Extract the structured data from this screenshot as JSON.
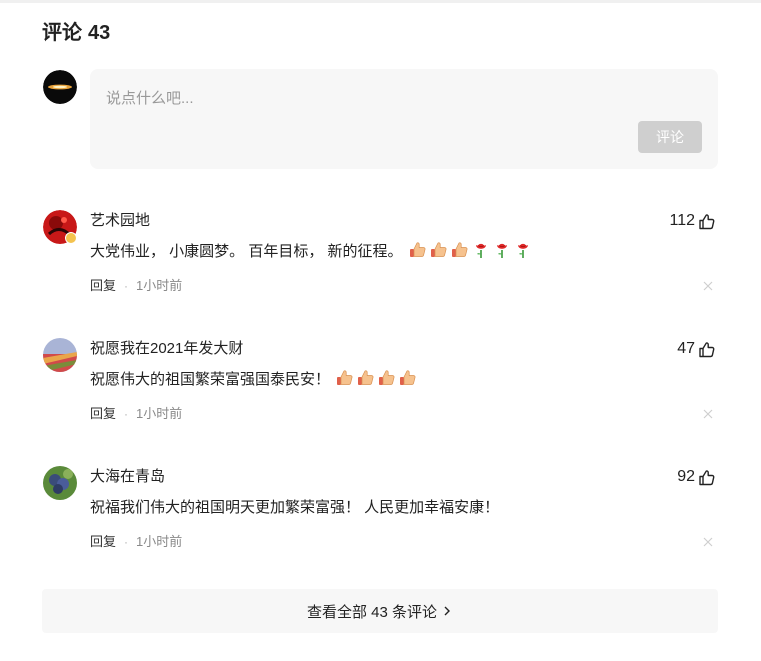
{
  "header": {
    "title": "评论",
    "count": "43"
  },
  "composer": {
    "placeholder": "说点什么吧...",
    "submit_label": "评论"
  },
  "comments": [
    {
      "name": "艺术园地",
      "likes": "112",
      "text": "大党伟业， 小康圆梦。 百年目标， 新的征程。",
      "emojis": [
        "thumbs-up",
        "thumbs-up",
        "thumbs-up",
        "rose",
        "rose",
        "rose"
      ],
      "reply_label": "回复",
      "separator": "·",
      "time": "1小时前",
      "verified": true
    },
    {
      "name": "祝愿我在2021年发大财",
      "likes": "47",
      "text": "祝愿伟大的祖国繁荣富强国泰民安！",
      "emojis": [
        "thumbs-up",
        "thumbs-up",
        "thumbs-up",
        "thumbs-up"
      ],
      "reply_label": "回复",
      "separator": "·",
      "time": "1小时前",
      "verified": false
    },
    {
      "name": "大海在青岛",
      "likes": "92",
      "text": "祝福我们伟大的祖国明天更加繁荣富强！ 人民更加幸福安康！",
      "emojis": [],
      "reply_label": "回复",
      "separator": "·",
      "time": "1小时前",
      "verified": false
    }
  ],
  "footer": {
    "more_label": "查看全部 43 条评论"
  },
  "colors": {
    "panel_bg": "#f7f7f7",
    "button_disabled": "#cfcfcf",
    "meta_gray": "#8a8a8a"
  }
}
